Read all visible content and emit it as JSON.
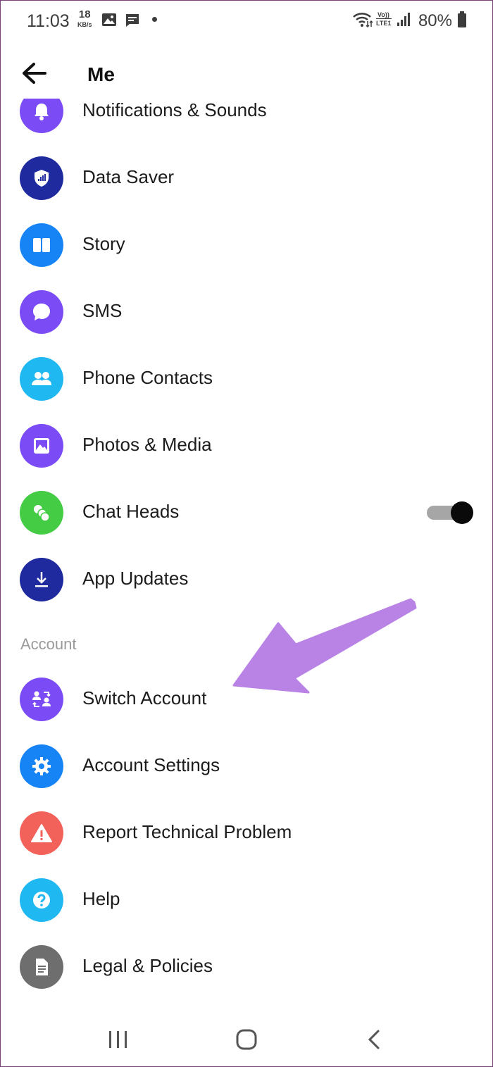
{
  "status_bar": {
    "time": "11:03",
    "speed_value": "18",
    "speed_unit": "KB/s",
    "battery": "80%"
  },
  "header": {
    "title": "Me"
  },
  "menu": {
    "items": [
      {
        "label": "Notifications & Sounds",
        "icon": "bell-icon",
        "color": "#7b4cf5"
      },
      {
        "label": "Data Saver",
        "icon": "shield-signal-icon",
        "color": "#1e2a9e"
      },
      {
        "label": "Story",
        "icon": "story-icon",
        "color": "#1784f6"
      },
      {
        "label": "SMS",
        "icon": "chat-bubble-icon",
        "color": "#7b4cf5"
      },
      {
        "label": "Phone Contacts",
        "icon": "contacts-icon",
        "color": "#20b8f0"
      },
      {
        "label": "Photos & Media",
        "icon": "image-icon",
        "color": "#7b4cf5"
      },
      {
        "label": "Chat Heads",
        "icon": "chat-heads-icon",
        "color": "#44cc44"
      },
      {
        "label": "App Updates",
        "icon": "download-icon",
        "color": "#1e2a9e"
      }
    ],
    "chat_heads_toggle_on": true
  },
  "account": {
    "section_label": "Account",
    "items": [
      {
        "label": "Switch Account",
        "icon": "switch-account-icon",
        "color": "#7b4cf5"
      },
      {
        "label": "Account Settings",
        "icon": "gear-icon",
        "color": "#1784f6"
      },
      {
        "label": "Report Technical Problem",
        "icon": "warning-icon",
        "color": "#f2625a"
      },
      {
        "label": "Help",
        "icon": "help-icon",
        "color": "#20b8f0"
      },
      {
        "label": "Legal & Policies",
        "icon": "document-icon",
        "color": "#6e6e6e"
      }
    ]
  },
  "annotation_color": "#b983e6"
}
